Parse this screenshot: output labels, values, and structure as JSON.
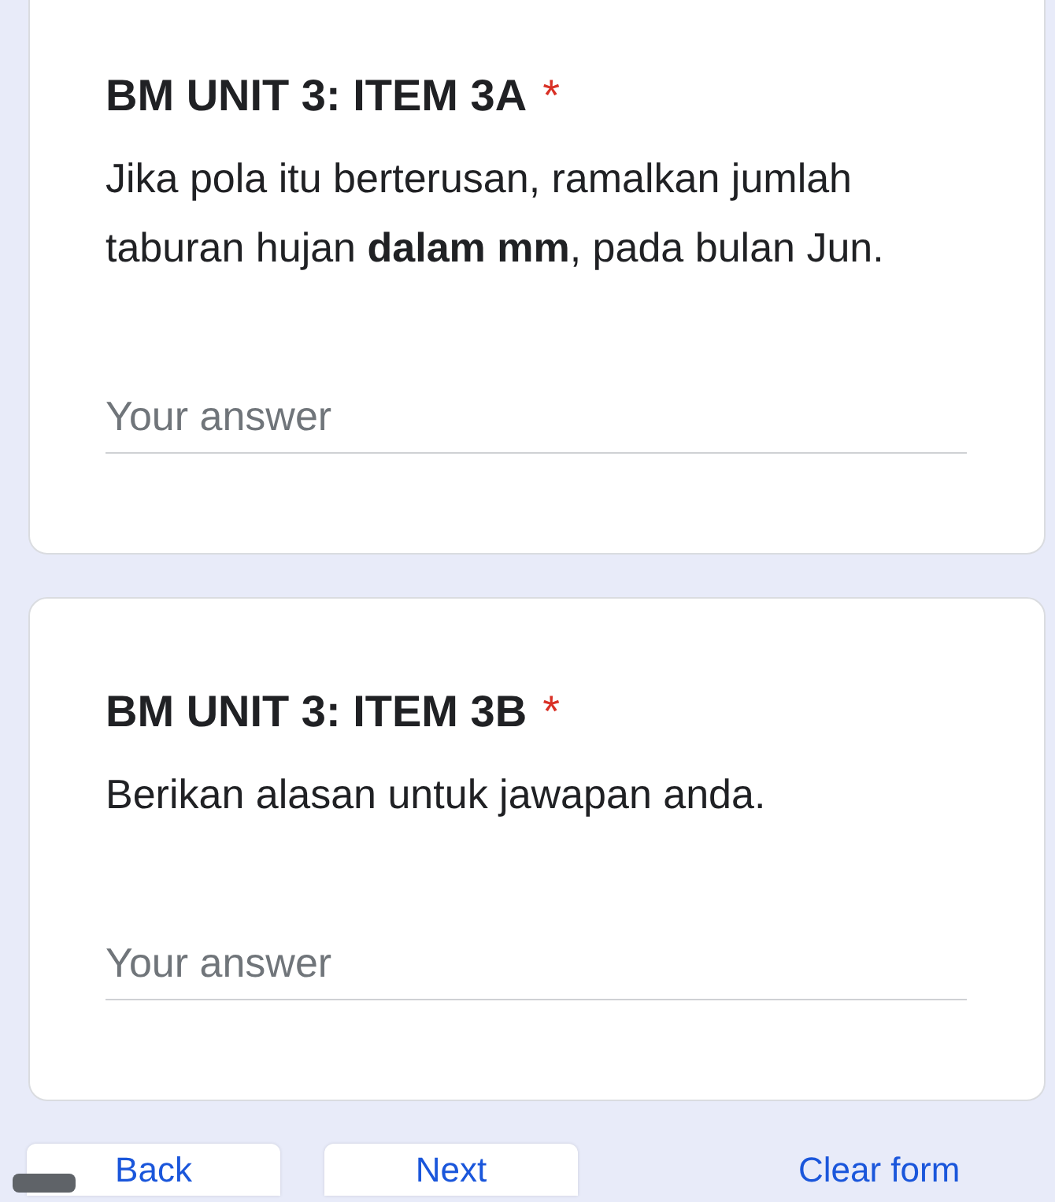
{
  "questions": [
    {
      "title": "BM UNIT 3: ITEM 3A",
      "required": true,
      "required_mark": "*",
      "description": "Jika pola itu berterusan, ramalkan jumlah taburan hujan **dalam mm**, pada bulan Jun.",
      "placeholder": "Your answer"
    },
    {
      "title": "BM UNIT 3: ITEM 3B",
      "required": true,
      "required_mark": "*",
      "description": "Berikan alasan untuk jawapan anda.",
      "placeholder": "Your answer"
    }
  ],
  "buttons": [
    {
      "label": "Back",
      "kind": "outlined"
    },
    {
      "label": "Next",
      "kind": "outlined"
    },
    {
      "label": "Clear form",
      "kind": "text"
    }
  ]
}
